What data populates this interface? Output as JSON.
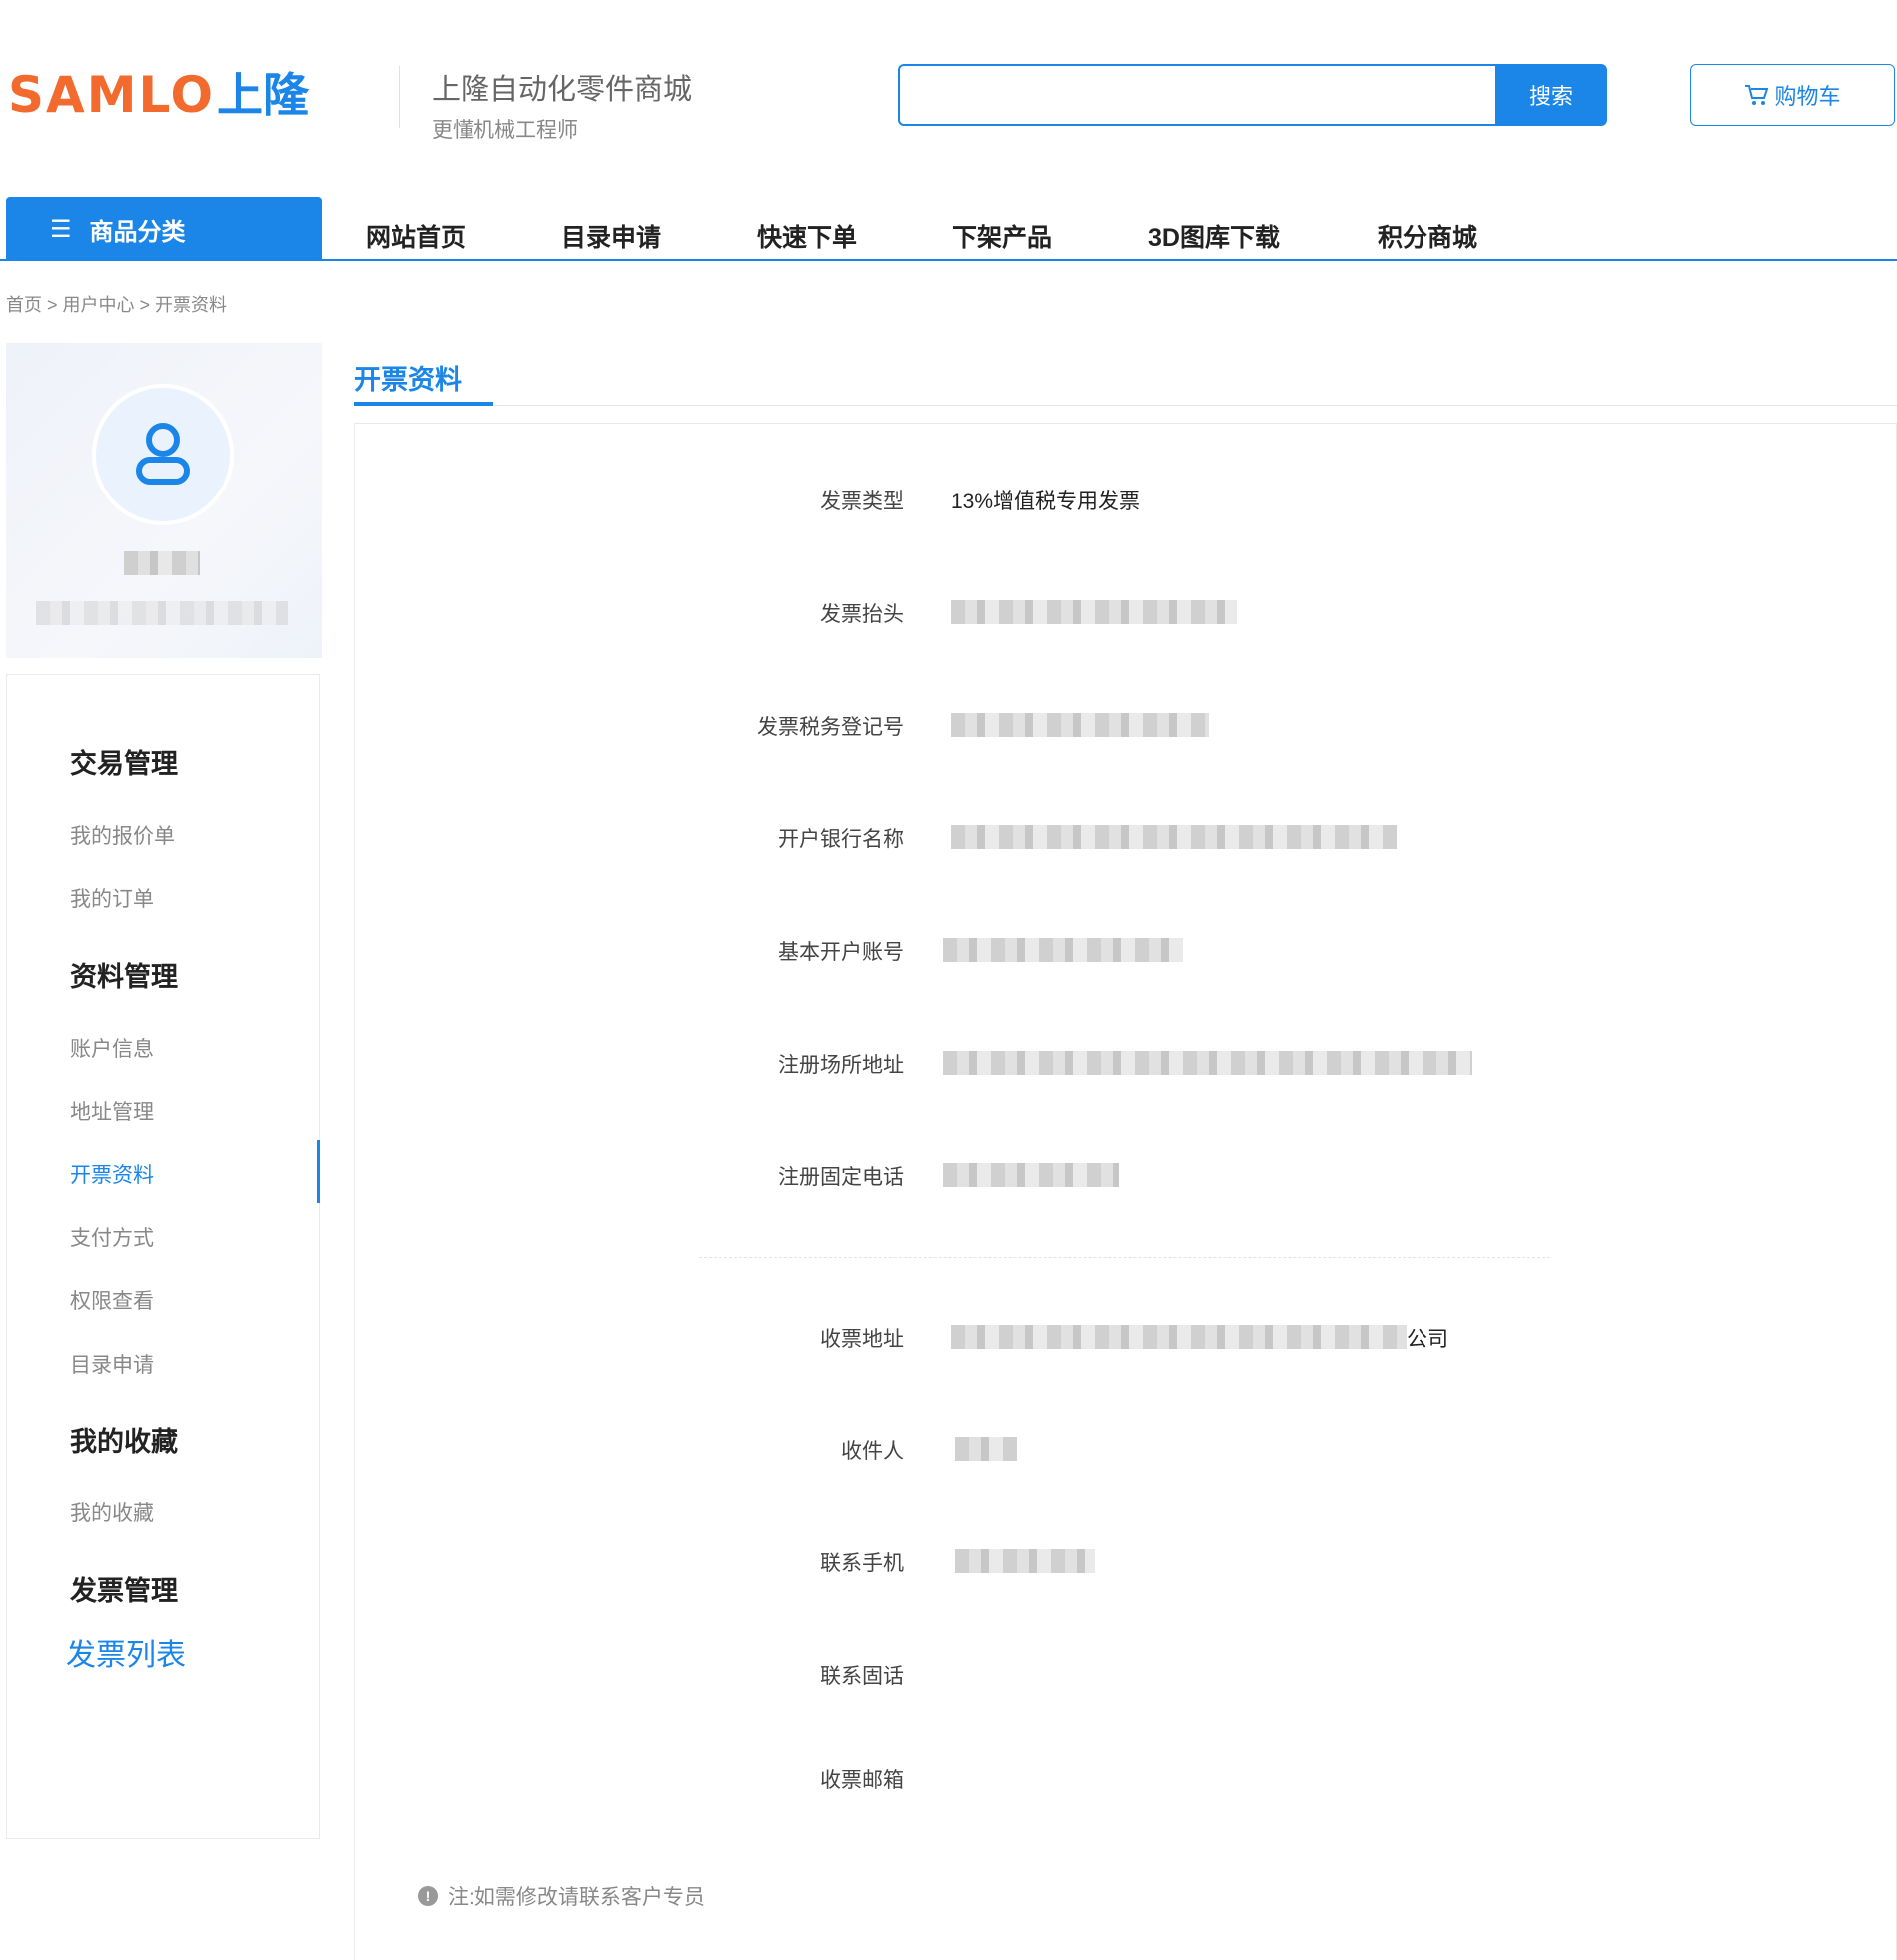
{
  "header": {
    "logo_en": "SAMLO",
    "logo_cn": "上隆",
    "site_name": "上隆自动化零件商城",
    "slogan": "更懂机械工程师",
    "search_placeholder": "",
    "search_button": "搜索",
    "cart_button": "购物车",
    "cart_icon": "cart-icon"
  },
  "nav": {
    "category_button": "商品分类",
    "items": [
      "网站首页",
      "目录申请",
      "快速下单",
      "下架产品",
      "3D图库下载",
      "积分商城"
    ]
  },
  "breadcrumb": "首页 > 用户中心 > 开票资料",
  "sidebar": {
    "groups": [
      {
        "title": "交易管理",
        "items": [
          "我的报价单",
          "我的订单"
        ]
      },
      {
        "title": "资料管理",
        "items": [
          "账户信息",
          "地址管理",
          "开票资料",
          "支付方式",
          "权限查看",
          "目录申请"
        ]
      },
      {
        "title": "我的收藏",
        "items": [
          "我的收藏"
        ]
      },
      {
        "title": "发票管理",
        "items": [
          "发票列表"
        ]
      }
    ],
    "active_item": "开票资料"
  },
  "main": {
    "title": "开票资料",
    "fields": [
      {
        "label": "发票类型",
        "value": "13%增值税专用发票"
      },
      {
        "label": "发票抬头",
        "value": ""
      },
      {
        "label": "发票税务登记号",
        "value": ""
      },
      {
        "label": "开户银行名称",
        "value": ""
      },
      {
        "label": "基本开户账号",
        "value": ""
      },
      {
        "label": "注册场所地址",
        "value": ""
      },
      {
        "label": "注册固定电话",
        "value": ""
      },
      {
        "label": "收票地址",
        "value": "公司"
      },
      {
        "label": "收件人",
        "value": ""
      },
      {
        "label": "联系手机",
        "value": ""
      },
      {
        "label": "联系固话",
        "value": ""
      },
      {
        "label": "收票邮箱",
        "value": ""
      }
    ],
    "note": "注:如需修改请联系客户专员"
  },
  "colors": {
    "accent": "#1b86e8",
    "logo_orange": "#f26a2e"
  }
}
